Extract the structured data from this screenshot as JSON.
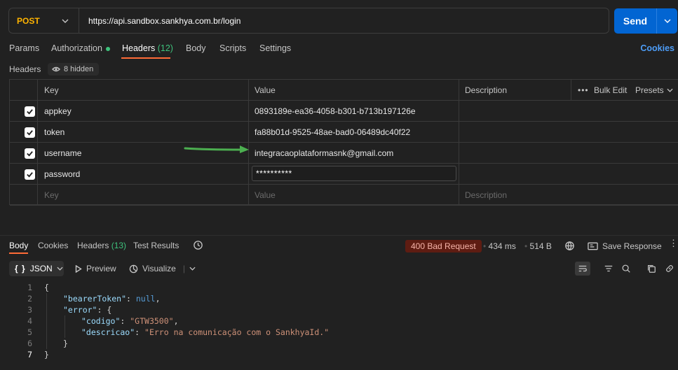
{
  "request": {
    "method": "POST",
    "url": "https://api.sandbox.sankhya.com.br/login",
    "send_label": "Send"
  },
  "request_tabs": {
    "params": "Params",
    "authorization": "Authorization",
    "headers": "Headers",
    "headers_count": "(12)",
    "body": "Body",
    "scripts": "Scripts",
    "settings": "Settings",
    "cookies": "Cookies"
  },
  "headers_section": {
    "title": "Headers",
    "hidden": "8 hidden",
    "columns": {
      "key": "Key",
      "value": "Value",
      "description": "Description",
      "bulk_edit": "Bulk Edit",
      "presets": "Presets"
    },
    "rows": [
      {
        "key": "appkey",
        "value": "0893189e-ea36-4058-b301-b713b197126e",
        "checked": true
      },
      {
        "key": "token",
        "value": "fa88b01d-9525-48ae-bad0-06489dc40f22",
        "checked": true
      },
      {
        "key": "username",
        "value": "integracaoplataformasnk@gmail.com",
        "checked": true
      },
      {
        "key": "password",
        "value": "**********",
        "checked": true
      }
    ],
    "placeholders": {
      "key": "Key",
      "value": "Value",
      "description": "Description"
    }
  },
  "response": {
    "tabs": {
      "body": "Body",
      "cookies": "Cookies",
      "headers": "Headers",
      "headers_count": "(13)",
      "test_results": "Test Results"
    },
    "status": "400 Bad Request",
    "time": "434 ms",
    "size": "514 B",
    "save_response": "Save Response",
    "format": "JSON",
    "preview": "Preview",
    "visualize": "Visualize",
    "lines": [
      "1",
      "2",
      "3",
      "4",
      "5",
      "6",
      "7"
    ],
    "json": {
      "open": "{",
      "bearer_key": "\"bearerToken\"",
      "bearer_val": "null",
      "error_key": "\"error\"",
      "codigo_key": "\"codigo\"",
      "codigo_val": "\"GTW3500\"",
      "descricao_key": "\"descricao\"",
      "descricao_val": "\"Erro na comunicação com o SankhyaId.\"",
      "inner_close": "}",
      "close": "}"
    }
  },
  "colors": {
    "accent": "#ff6c37",
    "send": "#0265d2",
    "method": "#ffb400",
    "count_green": "#3ec27c",
    "status_bg": "#5e1c12",
    "arrow": "#4caf50"
  }
}
